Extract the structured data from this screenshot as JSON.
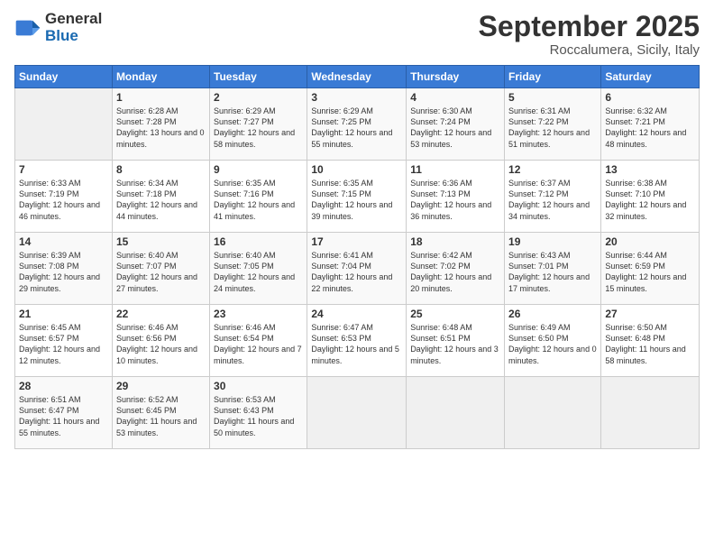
{
  "logo": {
    "general": "General",
    "blue": "Blue"
  },
  "header": {
    "month": "September 2025",
    "location": "Roccalumera, Sicily, Italy"
  },
  "weekdays": [
    "Sunday",
    "Monday",
    "Tuesday",
    "Wednesday",
    "Thursday",
    "Friday",
    "Saturday"
  ],
  "weeks": [
    [
      {
        "day": "",
        "sunrise": "",
        "sunset": "",
        "daylight": ""
      },
      {
        "day": "1",
        "sunrise": "Sunrise: 6:28 AM",
        "sunset": "Sunset: 7:28 PM",
        "daylight": "Daylight: 13 hours and 0 minutes."
      },
      {
        "day": "2",
        "sunrise": "Sunrise: 6:29 AM",
        "sunset": "Sunset: 7:27 PM",
        "daylight": "Daylight: 12 hours and 58 minutes."
      },
      {
        "day": "3",
        "sunrise": "Sunrise: 6:29 AM",
        "sunset": "Sunset: 7:25 PM",
        "daylight": "Daylight: 12 hours and 55 minutes."
      },
      {
        "day": "4",
        "sunrise": "Sunrise: 6:30 AM",
        "sunset": "Sunset: 7:24 PM",
        "daylight": "Daylight: 12 hours and 53 minutes."
      },
      {
        "day": "5",
        "sunrise": "Sunrise: 6:31 AM",
        "sunset": "Sunset: 7:22 PM",
        "daylight": "Daylight: 12 hours and 51 minutes."
      },
      {
        "day": "6",
        "sunrise": "Sunrise: 6:32 AM",
        "sunset": "Sunset: 7:21 PM",
        "daylight": "Daylight: 12 hours and 48 minutes."
      }
    ],
    [
      {
        "day": "7",
        "sunrise": "Sunrise: 6:33 AM",
        "sunset": "Sunset: 7:19 PM",
        "daylight": "Daylight: 12 hours and 46 minutes."
      },
      {
        "day": "8",
        "sunrise": "Sunrise: 6:34 AM",
        "sunset": "Sunset: 7:18 PM",
        "daylight": "Daylight: 12 hours and 44 minutes."
      },
      {
        "day": "9",
        "sunrise": "Sunrise: 6:35 AM",
        "sunset": "Sunset: 7:16 PM",
        "daylight": "Daylight: 12 hours and 41 minutes."
      },
      {
        "day": "10",
        "sunrise": "Sunrise: 6:35 AM",
        "sunset": "Sunset: 7:15 PM",
        "daylight": "Daylight: 12 hours and 39 minutes."
      },
      {
        "day": "11",
        "sunrise": "Sunrise: 6:36 AM",
        "sunset": "Sunset: 7:13 PM",
        "daylight": "Daylight: 12 hours and 36 minutes."
      },
      {
        "day": "12",
        "sunrise": "Sunrise: 6:37 AM",
        "sunset": "Sunset: 7:12 PM",
        "daylight": "Daylight: 12 hours and 34 minutes."
      },
      {
        "day": "13",
        "sunrise": "Sunrise: 6:38 AM",
        "sunset": "Sunset: 7:10 PM",
        "daylight": "Daylight: 12 hours and 32 minutes."
      }
    ],
    [
      {
        "day": "14",
        "sunrise": "Sunrise: 6:39 AM",
        "sunset": "Sunset: 7:08 PM",
        "daylight": "Daylight: 12 hours and 29 minutes."
      },
      {
        "day": "15",
        "sunrise": "Sunrise: 6:40 AM",
        "sunset": "Sunset: 7:07 PM",
        "daylight": "Daylight: 12 hours and 27 minutes."
      },
      {
        "day": "16",
        "sunrise": "Sunrise: 6:40 AM",
        "sunset": "Sunset: 7:05 PM",
        "daylight": "Daylight: 12 hours and 24 minutes."
      },
      {
        "day": "17",
        "sunrise": "Sunrise: 6:41 AM",
        "sunset": "Sunset: 7:04 PM",
        "daylight": "Daylight: 12 hours and 22 minutes."
      },
      {
        "day": "18",
        "sunrise": "Sunrise: 6:42 AM",
        "sunset": "Sunset: 7:02 PM",
        "daylight": "Daylight: 12 hours and 20 minutes."
      },
      {
        "day": "19",
        "sunrise": "Sunrise: 6:43 AM",
        "sunset": "Sunset: 7:01 PM",
        "daylight": "Daylight: 12 hours and 17 minutes."
      },
      {
        "day": "20",
        "sunrise": "Sunrise: 6:44 AM",
        "sunset": "Sunset: 6:59 PM",
        "daylight": "Daylight: 12 hours and 15 minutes."
      }
    ],
    [
      {
        "day": "21",
        "sunrise": "Sunrise: 6:45 AM",
        "sunset": "Sunset: 6:57 PM",
        "daylight": "Daylight: 12 hours and 12 minutes."
      },
      {
        "day": "22",
        "sunrise": "Sunrise: 6:46 AM",
        "sunset": "Sunset: 6:56 PM",
        "daylight": "Daylight: 12 hours and 10 minutes."
      },
      {
        "day": "23",
        "sunrise": "Sunrise: 6:46 AM",
        "sunset": "Sunset: 6:54 PM",
        "daylight": "Daylight: 12 hours and 7 minutes."
      },
      {
        "day": "24",
        "sunrise": "Sunrise: 6:47 AM",
        "sunset": "Sunset: 6:53 PM",
        "daylight": "Daylight: 12 hours and 5 minutes."
      },
      {
        "day": "25",
        "sunrise": "Sunrise: 6:48 AM",
        "sunset": "Sunset: 6:51 PM",
        "daylight": "Daylight: 12 hours and 3 minutes."
      },
      {
        "day": "26",
        "sunrise": "Sunrise: 6:49 AM",
        "sunset": "Sunset: 6:50 PM",
        "daylight": "Daylight: 12 hours and 0 minutes."
      },
      {
        "day": "27",
        "sunrise": "Sunrise: 6:50 AM",
        "sunset": "Sunset: 6:48 PM",
        "daylight": "Daylight: 11 hours and 58 minutes."
      }
    ],
    [
      {
        "day": "28",
        "sunrise": "Sunrise: 6:51 AM",
        "sunset": "Sunset: 6:47 PM",
        "daylight": "Daylight: 11 hours and 55 minutes."
      },
      {
        "day": "29",
        "sunrise": "Sunrise: 6:52 AM",
        "sunset": "Sunset: 6:45 PM",
        "daylight": "Daylight: 11 hours and 53 minutes."
      },
      {
        "day": "30",
        "sunrise": "Sunrise: 6:53 AM",
        "sunset": "Sunset: 6:43 PM",
        "daylight": "Daylight: 11 hours and 50 minutes."
      },
      {
        "day": "",
        "sunrise": "",
        "sunset": "",
        "daylight": ""
      },
      {
        "day": "",
        "sunrise": "",
        "sunset": "",
        "daylight": ""
      },
      {
        "day": "",
        "sunrise": "",
        "sunset": "",
        "daylight": ""
      },
      {
        "day": "",
        "sunrise": "",
        "sunset": "",
        "daylight": ""
      }
    ]
  ]
}
